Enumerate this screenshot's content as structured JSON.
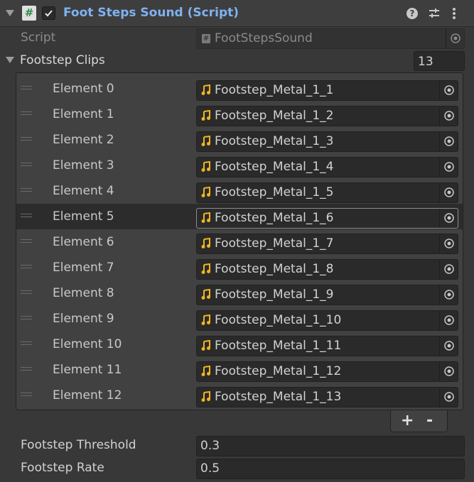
{
  "component": {
    "title": "Foot Steps Sound (Script)",
    "enabled": true,
    "icons": [
      "help-icon",
      "preset-icon",
      "kebab-menu-icon"
    ]
  },
  "script": {
    "label": "Script",
    "value": "FootStepsSound"
  },
  "footstep_clips": {
    "label": "Footstep Clips",
    "size": "13",
    "selected_index": 5,
    "elements": [
      {
        "label": "Element 0",
        "value": "Footstep_Metal_1_1"
      },
      {
        "label": "Element 1",
        "value": "Footstep_Metal_1_2"
      },
      {
        "label": "Element 2",
        "value": "Footstep_Metal_1_3"
      },
      {
        "label": "Element 3",
        "value": "Footstep_Metal_1_4"
      },
      {
        "label": "Element 4",
        "value": "Footstep_Metal_1_5"
      },
      {
        "label": "Element 5",
        "value": "Footstep_Metal_1_6"
      },
      {
        "label": "Element 6",
        "value": "Footstep_Metal_1_7"
      },
      {
        "label": "Element 7",
        "value": "Footstep_Metal_1_8"
      },
      {
        "label": "Element 8",
        "value": "Footstep_Metal_1_9"
      },
      {
        "label": "Element 9",
        "value": "Footstep_Metal_1_10"
      },
      {
        "label": "Element 10",
        "value": "Footstep_Metal_1_11"
      },
      {
        "label": "Element 11",
        "value": "Footstep_Metal_1_12"
      },
      {
        "label": "Element 12",
        "value": "Footstep_Metal_1_13"
      }
    ],
    "add_label": "+",
    "remove_label": "-"
  },
  "footstep_threshold": {
    "label": "Footstep Threshold",
    "value": "0.3"
  },
  "footstep_rate": {
    "label": "Footstep Rate",
    "value": "0.5"
  },
  "colors": {
    "background": "#383838",
    "title_accent": "#7fb2f0",
    "audio_icon": "#f0b41e"
  }
}
